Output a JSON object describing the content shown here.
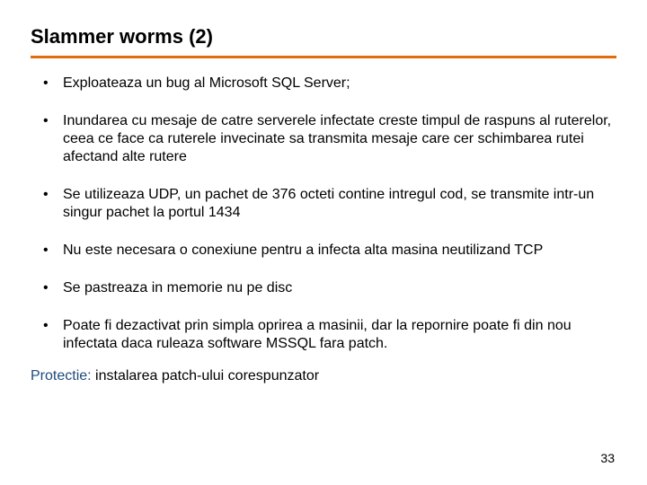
{
  "title": "Slammer worms (2)",
  "bullets": [
    "Exploateaza un bug al Microsoft SQL Server;",
    "Inundarea cu mesaje de catre serverele infectate creste timpul de raspuns al ruterelor, ceea ce face ca ruterele invecinate sa transmita mesaje care cer schimbarea rutei afectand alte rutere",
    "Se utilizeaza UDP, un pachet de 376 octeti contine intregul cod, se transmite intr-un singur pachet la portul 1434",
    "Nu este necesara o conexiune pentru a infecta alta masina neutilizand TCP",
    "Se pastreaza in memorie nu pe disc",
    "Poate fi dezactivat prin simpla oprirea a masinii, dar la repornire poate fi din nou infectata daca ruleaza software MSSQL fara patch."
  ],
  "protection": {
    "label": "Protectie:",
    "text": " instalarea patch-ului corespunzator"
  },
  "pageNumber": "33"
}
